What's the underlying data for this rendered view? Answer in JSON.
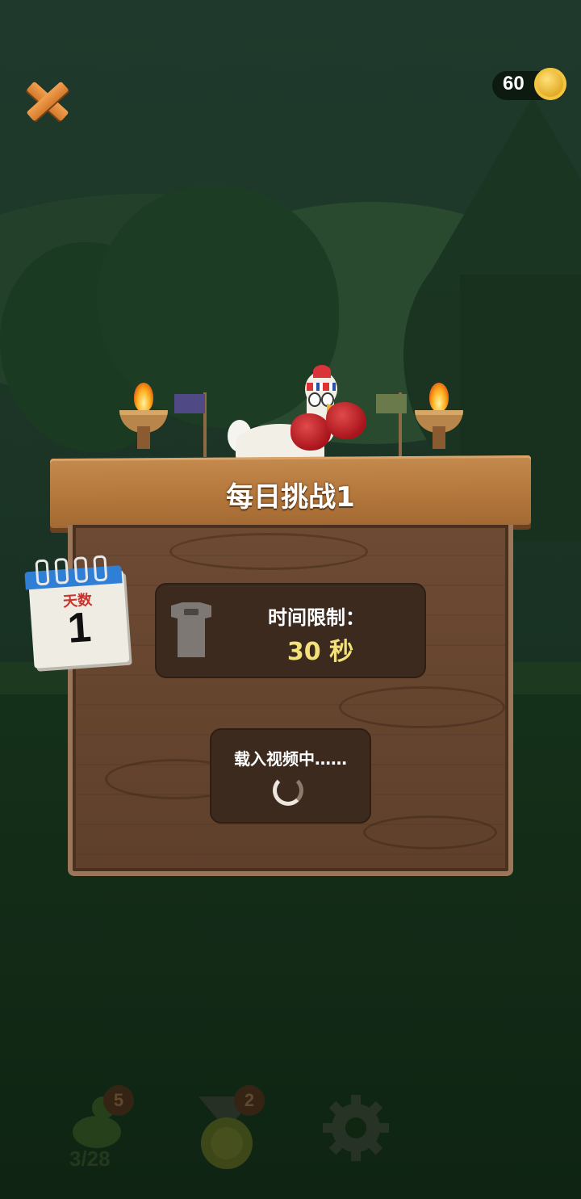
{
  "header": {
    "close_icon": "close-x-icon",
    "coins": "60",
    "coin_icon": "gold-coin-icon"
  },
  "sign": {
    "title": "每日挑战1"
  },
  "calendar": {
    "label": "天数",
    "day": "1"
  },
  "time_limit": {
    "icon": "shirt-icon",
    "label": "时间限制：",
    "value": "30 秒"
  },
  "video": {
    "label": "载入视频中……",
    "icon": "loading-spinner-icon"
  },
  "bottom_nav": {
    "characters": {
      "icon": "chicken-icon",
      "badge": "5",
      "progress": "3/28"
    },
    "achievements": {
      "icon": "medal-icon",
      "badge": "2"
    },
    "settings": {
      "icon": "gear-icon"
    }
  },
  "colors": {
    "coin_gold": "#e0a820",
    "time_value": "#f3e27a",
    "calendar_blue": "#2f7fd6",
    "close_orange": "#e89040"
  }
}
